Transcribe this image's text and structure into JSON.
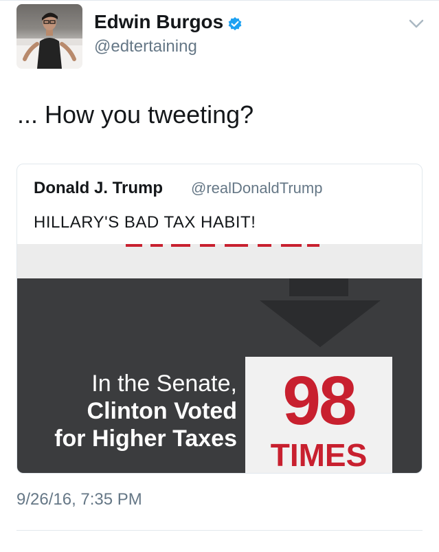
{
  "tweet": {
    "author": {
      "display_name": "Edwin Burgos",
      "handle": "@edtertaining",
      "verified_icon": "verified-badge-icon",
      "avatar_image": "profile-photo"
    },
    "menu_icon": "chevron-down-icon",
    "text": "... How you tweeting?",
    "timestamp": "9/26/16, 7:35 PM"
  },
  "quoted_tweet": {
    "author": {
      "display_name": "Donald J. Trump",
      "handle": "@realDonaldTrump"
    },
    "text": "HILLARY'S BAD TAX HABIT!",
    "media": {
      "caption_lines": [
        "In the Senate,",
        "Clinton Voted",
        "for Higher Taxes"
      ],
      "stat_number": "98",
      "stat_unit": "TIMES"
    }
  },
  "colors": {
    "text_primary": "#14171a",
    "text_secondary": "#657786",
    "verified_blue": "#1da1f2",
    "divider": "#e1e8ed",
    "media_dark": "#3b3c3e",
    "stat_red": "#c8202f"
  }
}
